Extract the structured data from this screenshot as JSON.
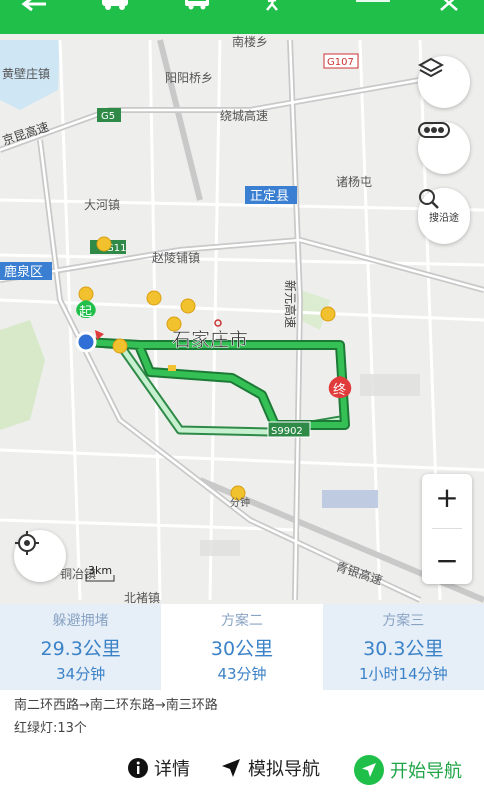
{
  "map": {
    "labels": {
      "nanlou": "南楼乡",
      "huangbi": "黄壁庄镇",
      "yaoyang": "阳阳桥乡",
      "g107": "G107",
      "g5": "G5",
      "raocheng": "绕城高速",
      "jing_kun": "京昆高速",
      "zhengding": "正定县",
      "zhuyang": "诸杨屯",
      "dahe": "大河镇",
      "g11": "G11",
      "luquan": "鹿泉区",
      "zhaoling": "赵陵铺镇",
      "xinyuan": "新元高速",
      "city": "石家庄市",
      "s9902": "S9902",
      "fenzhong": "分钟",
      "qingyin": "青银高速",
      "beizhu": "北褚镇",
      "tongye": "铜冶镇",
      "shi": "乡",
      "yiduo": "镇"
    },
    "start_badge": "起",
    "end_badge": "终",
    "scale": "3km",
    "search_along_label": "搜沿途",
    "zoom_in": "+",
    "zoom_out": "−"
  },
  "routes": [
    {
      "tag": "躲避拥堵",
      "distance": "29.3公里",
      "duration": "34分钟",
      "active": false
    },
    {
      "tag": "方案二",
      "distance": "30公里",
      "duration": "43分钟",
      "active": true
    },
    {
      "tag": "方案三",
      "distance": "30.3公里",
      "duration": "1小时14分钟",
      "active": false
    }
  ],
  "route_roads": "南二环西路→南二环东路→南三环路",
  "traffic_lights": "红绿灯:13个",
  "actions": {
    "details": "详情",
    "simulate": "模拟导航",
    "start": "开始导航"
  },
  "colors": {
    "brand": "#1fbf4a",
    "route_main": "#2fb34b",
    "route_alt": "#c6f0d0",
    "accent_blue": "#3b82c7"
  }
}
